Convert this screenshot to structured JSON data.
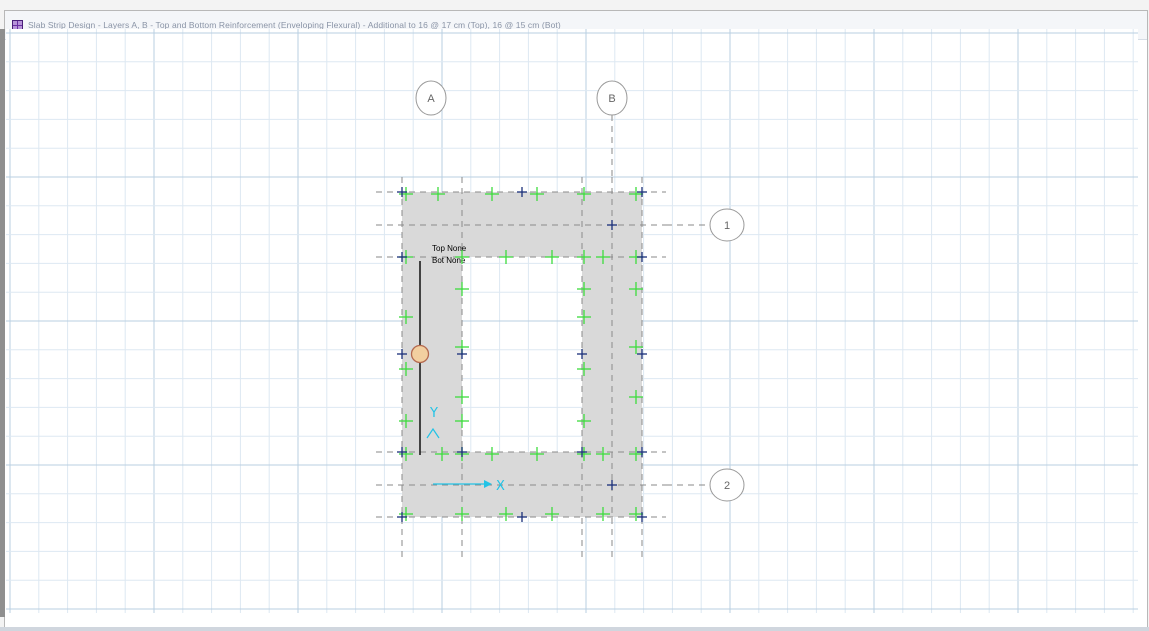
{
  "window": {
    "title": "Slab Strip Design - Layers A, B - Top and Bottom Reinforcement (Enveloping Flexural) - Additional to 16 @ 17 cm (Top), 16 @ 15 cm (Bot)"
  },
  "grid_bubbles": {
    "a": "A",
    "b": "B",
    "one": "1",
    "two": "2"
  },
  "strip_label": {
    "top": "Top None",
    "bot": "Bot None"
  },
  "axes": {
    "y": "Y",
    "x": "X"
  },
  "colors": {
    "slab_fill": "#d9d9d9",
    "minor_grid": "#dde8f2",
    "major_grid": "#b9cfe2",
    "dim_line": "#8a8a8a",
    "point_green": "#3ddc3d",
    "point_navy": "#1a2f7a",
    "axis_cyan": "#22c3e6",
    "selection_fill": "#f2cfa0",
    "selection_stroke": "#b46a50",
    "app_icon": "#6a2fa3"
  },
  "icons": {
    "app": "slab-grid-icon",
    "selected_point": "selected-point-icon"
  }
}
